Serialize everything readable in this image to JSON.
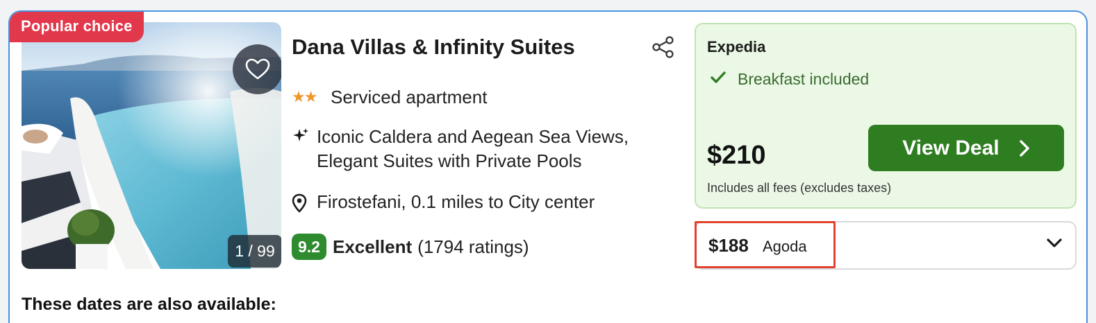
{
  "listing": {
    "badge": "Popular choice",
    "image_counter": "1 / 99",
    "title": "Dana Villas & Infinity Suites",
    "stars": "★★",
    "property_type": "Serviced apartment",
    "amenities": [
      "Iconic Caldera and Aegean Sea Views,",
      "Elegant Suites with Private Pools"
    ],
    "location": "Firostefani, 0.1 miles to City center",
    "score": "9.2",
    "rating_word": "Excellent",
    "rating_count": "(1794 ratings)"
  },
  "primary_deal": {
    "provider": "Expedia",
    "perk": "Breakfast included",
    "price": "$210",
    "fees_note": "Includes all fees (excludes taxes)",
    "cta": "View Deal"
  },
  "alt_deal": {
    "price": "$188",
    "provider": "Agoda"
  },
  "section": {
    "dates_heading": "These dates are also available:"
  },
  "colors": {
    "badge_red": "#e2384c",
    "score_green": "#2e8b2e",
    "deal_bg": "#ebf8e6",
    "cta_green": "#2e7d21",
    "highlight_red": "#e0422c",
    "card_border": "#4a90e2"
  },
  "icons": [
    "heart-icon",
    "share-icon",
    "star-icon",
    "sparkle-icon",
    "location-pin-icon",
    "checkmark-icon",
    "chevron-right-icon",
    "chevron-down-icon"
  ]
}
